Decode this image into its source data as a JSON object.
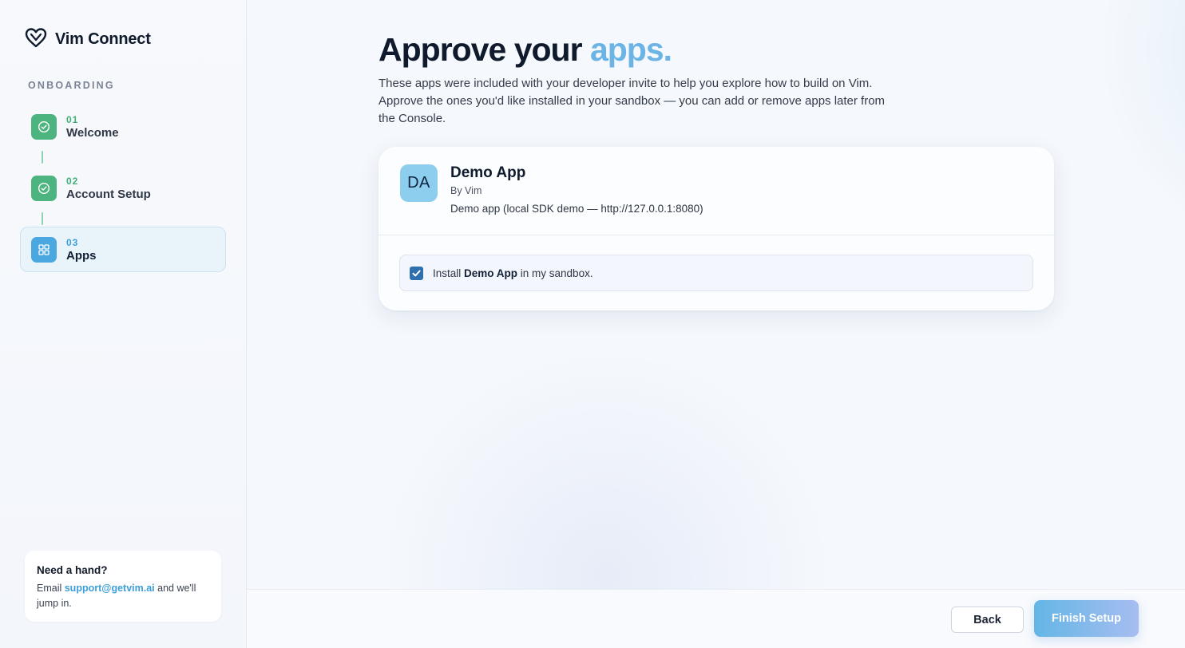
{
  "brand": {
    "name": "Vim Connect"
  },
  "sidebar": {
    "section_label": "ONBOARDING",
    "steps": [
      {
        "num": "01",
        "title": "Welcome",
        "state": "done",
        "icon": "check-circle-icon"
      },
      {
        "num": "02",
        "title": "Account Setup",
        "state": "done",
        "icon": "check-circle-icon"
      },
      {
        "num": "03",
        "title": "Apps",
        "state": "current",
        "icon": "grid-icon"
      }
    ],
    "help": {
      "title": "Need a hand?",
      "prefix": "Email ",
      "email": "support@getvim.ai",
      "suffix": " and we'll jump in."
    }
  },
  "main": {
    "headline_prefix": "Approve your ",
    "headline_accent": "apps.",
    "subtitle": "These apps were included with your developer invite to help you explore how to build on Vim. Approve the ones you'd like installed in your sandbox — you can add or remove apps later from the Console.",
    "app": {
      "initials": "DA",
      "name": "Demo App",
      "by": "By Vim",
      "description": "Demo app (local SDK demo — http://127.0.0.1:8080)",
      "install_prefix": "Install ",
      "install_app": "Demo App",
      "install_suffix": " in my sandbox.",
      "install_checked": true
    }
  },
  "footer": {
    "back_label": "Back",
    "finish_label": "Finish Setup"
  },
  "colors": {
    "accent": "#6cb4e6",
    "done": "#4db37f",
    "current": "#4aa7df"
  }
}
